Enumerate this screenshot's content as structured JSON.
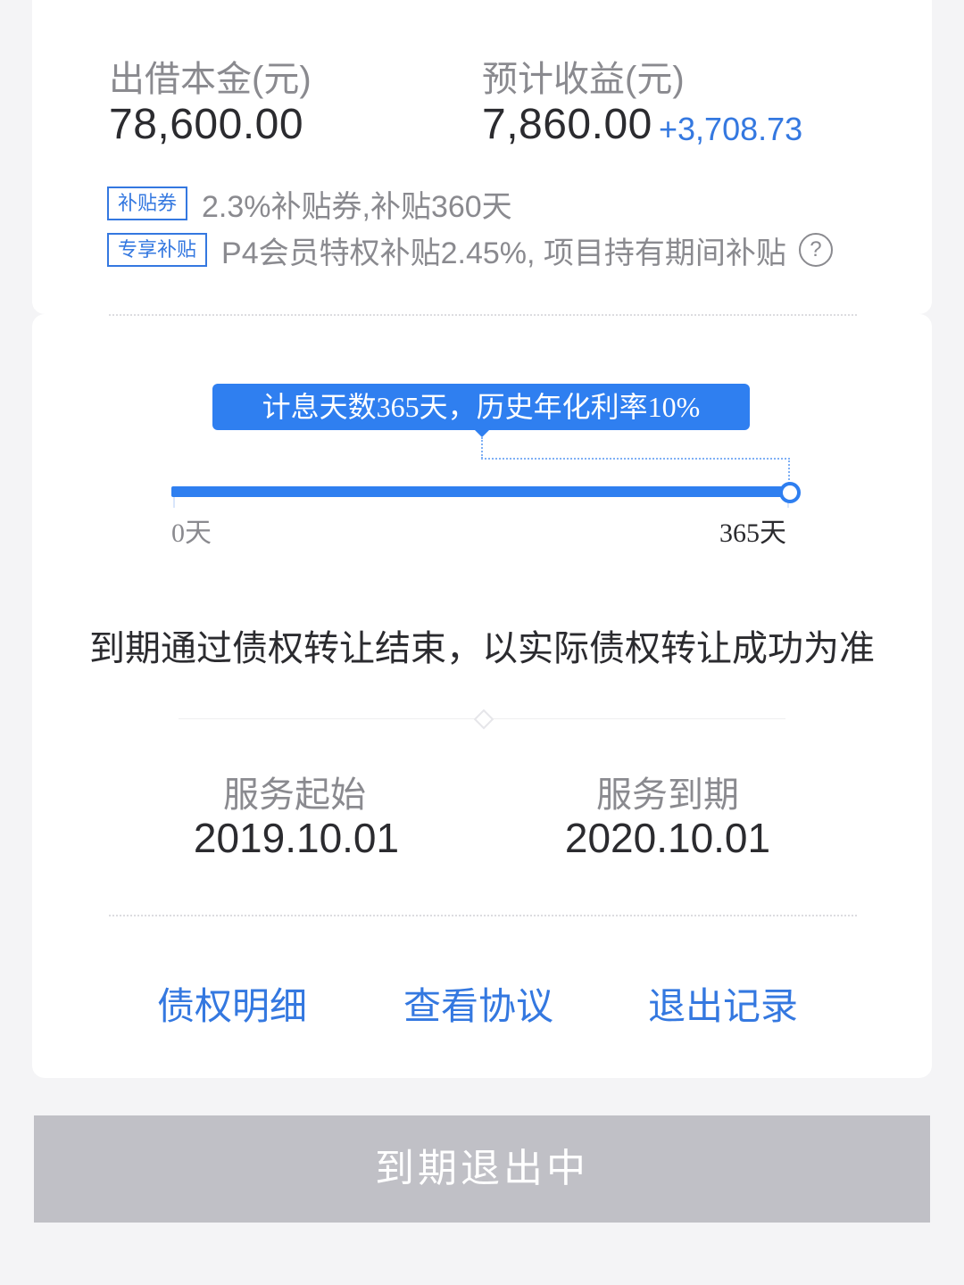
{
  "summary": {
    "principal_label": "出借本金(元)",
    "principal_value": "78,600.00",
    "earnings_label": "预计收益(元)",
    "earnings_value": "7,860.00",
    "earnings_extra": "+3,708.73"
  },
  "tags": [
    {
      "badge": "补贴券",
      "text": "2.3%补贴券,补贴360天"
    },
    {
      "badge": "专享补贴",
      "text": "P4会员特权补贴2.45%, 项目持有期间补贴"
    }
  ],
  "help_icon_glyph": "?",
  "timeline": {
    "tooltip": "计息天数365天，历史年化利率10%",
    "start_label": "0天",
    "end_label": "365天",
    "progress_fraction": 1.0
  },
  "notice": "到期通过债权转让结束，以实际债权转让成功为准",
  "service": {
    "start_label": "服务起始",
    "start_date": "2019.10.01",
    "end_label": "服务到期",
    "end_date": "2020.10.01"
  },
  "links": {
    "detail": "债权明细",
    "agreement": "查看协议",
    "exit_record": "退出记录"
  },
  "exit_button": "到期退出中",
  "colors": {
    "accent": "#2f7ff0",
    "link": "#3478e0",
    "button_disabled": "#c0c0c6"
  }
}
